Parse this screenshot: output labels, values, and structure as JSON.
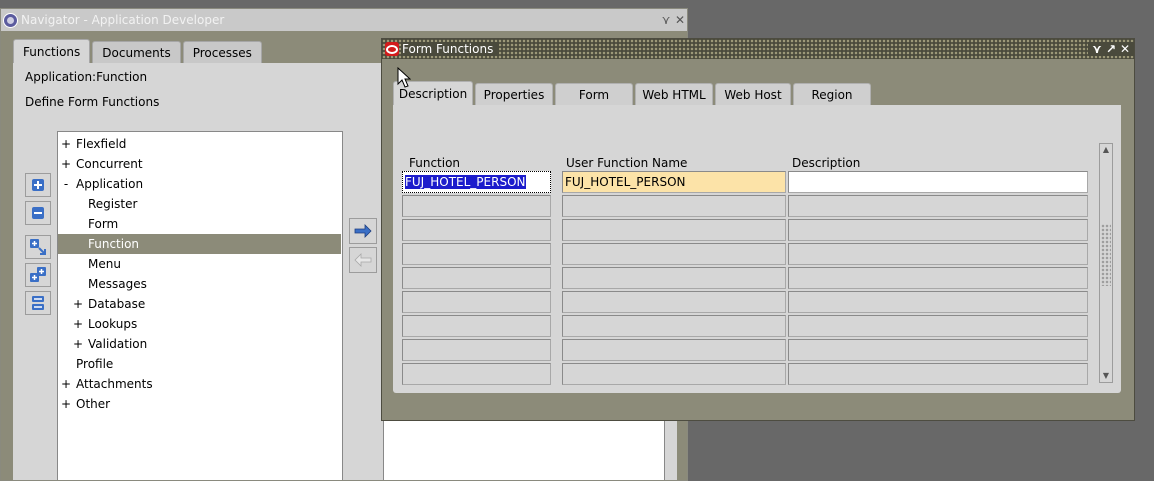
{
  "navigator": {
    "title": "Navigator - Application Developer",
    "controls": [
      "⋎",
      "✕"
    ],
    "tabs": [
      {
        "label": "Functions",
        "active": true
      },
      {
        "label": "Documents",
        "active": false
      },
      {
        "label": "Processes",
        "active": false
      }
    ],
    "context_label": "Application:Function",
    "section_label": "Define Form Functions",
    "tree": [
      {
        "exp": "+",
        "label": "Flexfield",
        "indent": 0,
        "selected": false
      },
      {
        "exp": "+",
        "label": "Concurrent",
        "indent": 0,
        "selected": false
      },
      {
        "exp": "-",
        "label": "Application",
        "indent": 0,
        "selected": false
      },
      {
        "exp": "",
        "label": "Register",
        "indent": 1,
        "selected": false
      },
      {
        "exp": "",
        "label": "Form",
        "indent": 1,
        "selected": false
      },
      {
        "exp": "",
        "label": "Function",
        "indent": 1,
        "selected": true
      },
      {
        "exp": "",
        "label": "Menu",
        "indent": 1,
        "selected": false
      },
      {
        "exp": "",
        "label": "Messages",
        "indent": 1,
        "selected": false
      },
      {
        "exp": "+",
        "label": "Database",
        "indent": 1,
        "selected": false
      },
      {
        "exp": "+",
        "label": "Lookups",
        "indent": 1,
        "selected": false
      },
      {
        "exp": "+",
        "label": "Validation",
        "indent": 1,
        "selected": false
      },
      {
        "exp": "",
        "label": "Profile",
        "indent": 0,
        "selected": false
      },
      {
        "exp": "+",
        "label": "Attachments",
        "indent": 0,
        "selected": false
      },
      {
        "exp": "+",
        "label": "Other",
        "indent": 0,
        "selected": false
      }
    ]
  },
  "form_functions": {
    "title": "Form Functions",
    "controls": [
      "⋎",
      "↗",
      "✕"
    ],
    "tabs": [
      {
        "label": "Description",
        "active": true
      },
      {
        "label": "Properties",
        "active": false
      },
      {
        "label": "Form",
        "active": false
      },
      {
        "label": "Web HTML",
        "active": false
      },
      {
        "label": "Web Host",
        "active": false
      },
      {
        "label": "Region",
        "active": false
      }
    ],
    "columns": [
      "Function",
      "User Function Name",
      "Description"
    ],
    "rows": [
      [
        "FUJ_HOTEL_PERSON",
        "FUJ_HOTEL_PERSON",
        ""
      ],
      [
        "",
        "",
        ""
      ],
      [
        "",
        "",
        ""
      ],
      [
        "",
        "",
        ""
      ],
      [
        "",
        "",
        ""
      ],
      [
        "",
        "",
        ""
      ],
      [
        "",
        "",
        ""
      ],
      [
        "",
        "",
        ""
      ],
      [
        "",
        "",
        ""
      ]
    ]
  },
  "colors": {
    "frame": "#8c8b79",
    "panel": "#d6d6d6",
    "selection": "#1c1ccc",
    "required_field": "#fce3a8"
  },
  "icons": [
    "application-icon",
    "oracle-icon",
    "expand-icon",
    "collapse-icon",
    "expand-all-icon",
    "expand-branch-icon",
    "collapse-all-icon",
    "move-right-arrow-icon",
    "move-left-arrow-icon"
  ]
}
